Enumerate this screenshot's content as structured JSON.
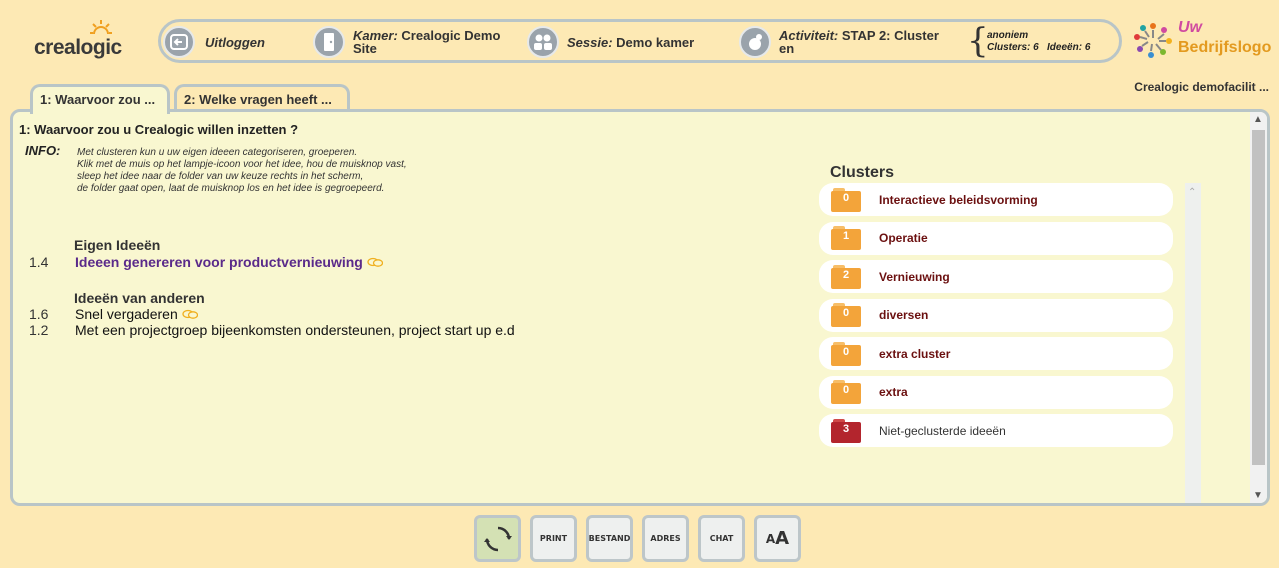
{
  "brand": {
    "logo_text": "crealogic",
    "company_logo_line1": "Uw",
    "company_logo_line2": "Bedrijfslogo",
    "facility": "Crealogic demofacilit ..."
  },
  "topbar": {
    "logout": "Uitloggen",
    "room_label": "Kamer:",
    "room_value_1": "Crealogic Demo",
    "room_value_2": "Site",
    "session_label": "Sessie:",
    "session_value": "Demo kamer",
    "activity_label": "Activiteit:",
    "activity_value_1": "STAP 2: Cluster",
    "activity_value_2": "en",
    "user": "anoniem",
    "clusters_stat": "Clusters: 6",
    "ideas_stat": "Ideeën: 6"
  },
  "tabs": [
    {
      "label": "1: Waarvoor zou ...",
      "active": true
    },
    {
      "label": "2: Welke vragen heeft ...",
      "active": false
    }
  ],
  "question": {
    "title": "1: Waarvoor zou u Crealogic willen inzetten ?",
    "info_label": "INFO:",
    "info_lines": [
      "Met clusteren kun u uw eigen ideeen categoriseren, groeperen.",
      "Klik met de muis op het lampje-icoon voor het idee, hou de muisknop vast,",
      "sleep het idee naar de folder van uw keuze rechts in het scherm,",
      "de folder gaat open, laat de muisknop los en het idee is gegroepeerd."
    ]
  },
  "own_ideas": {
    "heading": "Eigen Ideeën",
    "items": [
      {
        "num": "1.4",
        "text": "Ideeen genereren voor productvernieuwing"
      }
    ]
  },
  "other_ideas": {
    "heading": "Ideeën van anderen",
    "items": [
      {
        "num": "1.6",
        "text": "Snel vergaderen"
      },
      {
        "num": "1.2",
        "text": "Met een projectgroep bijeenkomsten ondersteunen, project start up e.d"
      }
    ]
  },
  "clusters": {
    "title": "Clusters",
    "items": [
      {
        "count": "0",
        "name": "Interactieve beleidsvorming"
      },
      {
        "count": "1",
        "name": "Operatie"
      },
      {
        "count": "2",
        "name": "Vernieuwing"
      },
      {
        "count": "0",
        "name": "diversen"
      },
      {
        "count": "0",
        "name": "extra cluster"
      },
      {
        "count": "0",
        "name": "extra"
      },
      {
        "count": "3",
        "name": "Niet-geclusterde ideeën"
      }
    ]
  },
  "toolbar": {
    "print": "PRINT",
    "file": "BESTAND",
    "address": "ADRES",
    "chat": "CHAT",
    "font_small": "A",
    "font_large": "A"
  },
  "colors": {
    "background": "#fde9b4",
    "panel": "#f9f7d0",
    "border": "#b9c5c7",
    "folder": "#f3a43a",
    "folder_unclustered": "#b3252d",
    "cluster_text": "#6b1010",
    "own_idea": "#5a2a8a"
  }
}
